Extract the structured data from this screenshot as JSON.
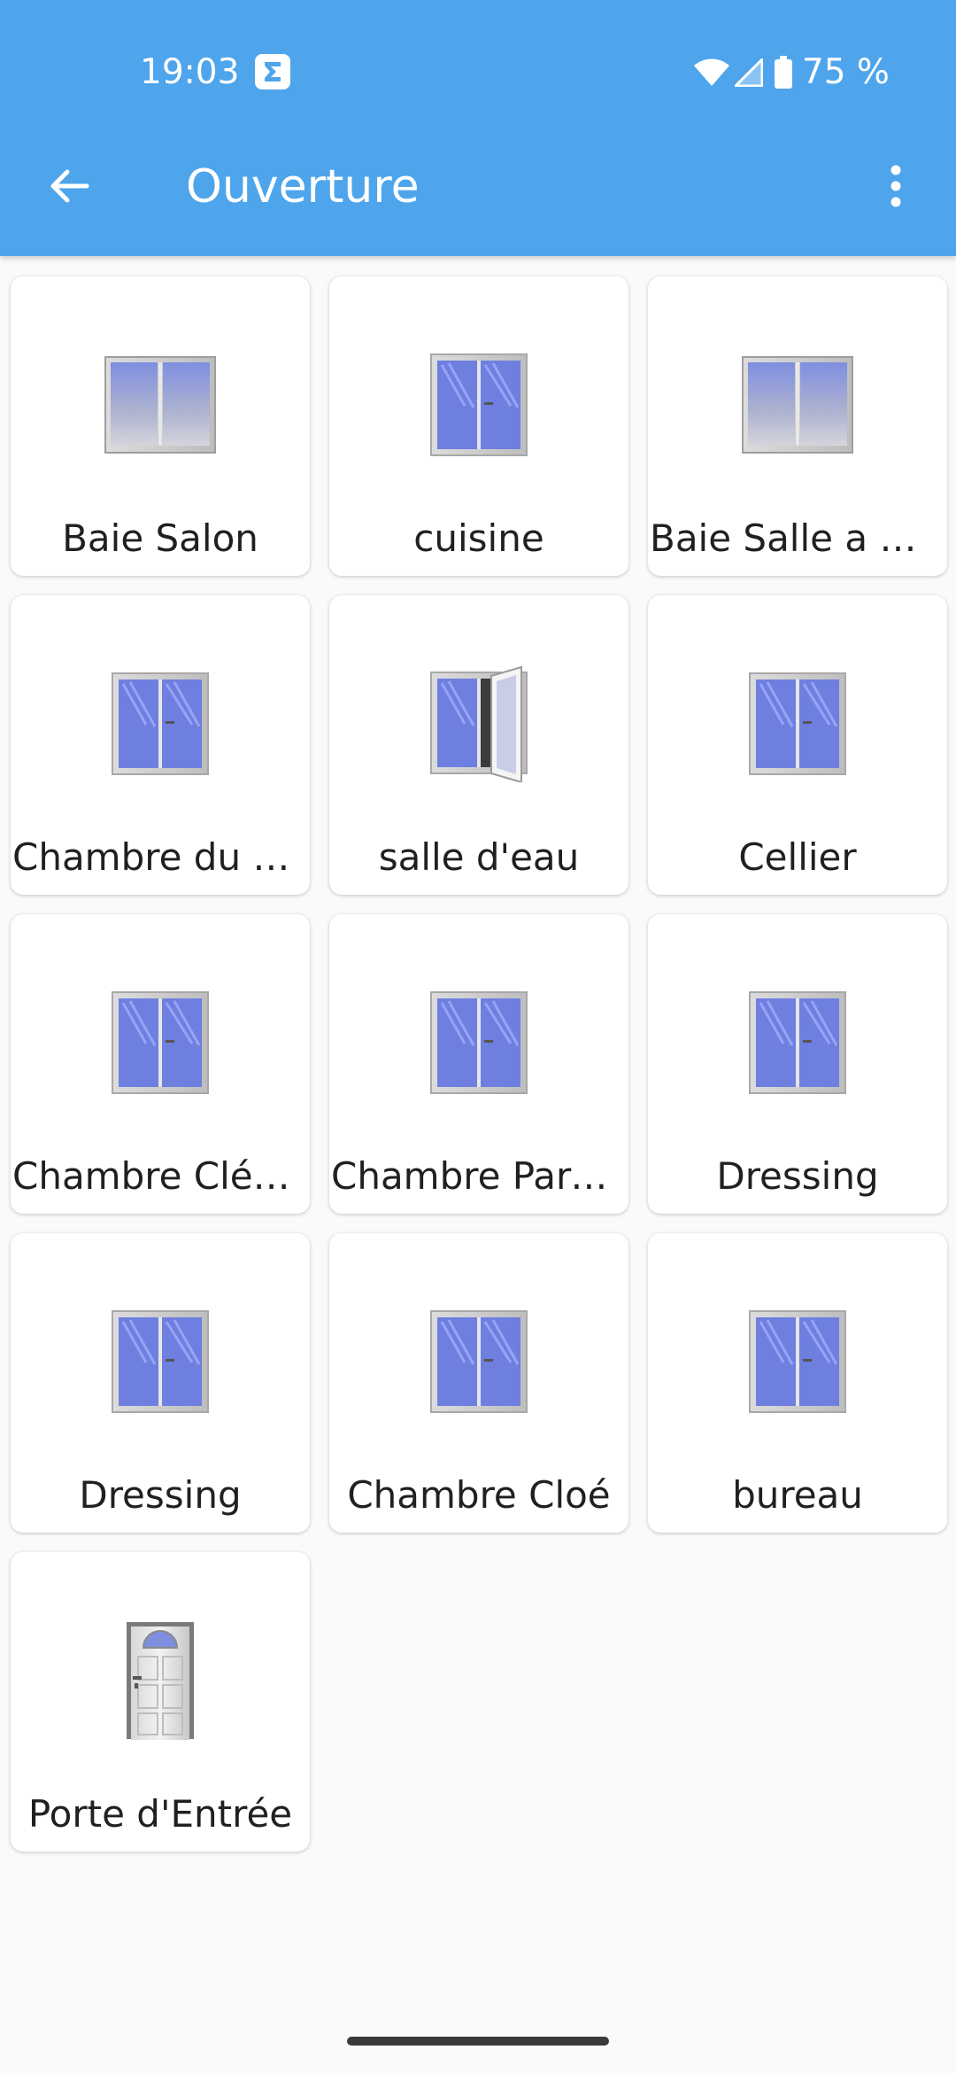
{
  "status_bar": {
    "time": "19:03",
    "battery": "75 %",
    "app_icon": "sigma-icon",
    "icons": [
      "wifi-icon",
      "signal-icon",
      "battery-icon"
    ]
  },
  "toolbar": {
    "title": "Ouverture",
    "back_icon": "arrow-left-icon",
    "menu_icon": "more-vert-icon",
    "color": "#4ea5ec"
  },
  "tiles": [
    {
      "label": "Baie Salon",
      "icon": "sliding-window-icon"
    },
    {
      "label": "cuisine",
      "icon": "window-closed-icon"
    },
    {
      "label": "Baie Salle a manger",
      "icon": "sliding-window-icon"
    },
    {
      "label": "Chambre du Bas",
      "icon": "window-closed-icon"
    },
    {
      "label": "salle d'eau",
      "icon": "window-open-icon"
    },
    {
      "label": "Cellier",
      "icon": "window-closed-icon"
    },
    {
      "label": "Chambre Clément",
      "icon": "window-closed-icon"
    },
    {
      "label": "Chambre Parents",
      "icon": "window-closed-icon"
    },
    {
      "label": "Dressing",
      "icon": "window-closed-icon"
    },
    {
      "label": "Dressing",
      "icon": "window-closed-icon"
    },
    {
      "label": "Chambre Cloé",
      "icon": "window-closed-icon"
    },
    {
      "label": "bureau",
      "icon": "window-closed-icon"
    },
    {
      "label": "Porte d'Entrée",
      "icon": "door-closed-icon"
    }
  ]
}
